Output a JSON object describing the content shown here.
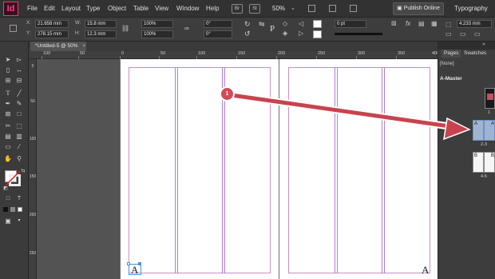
{
  "app": {
    "logo": "Id",
    "menu": [
      "File",
      "Edit",
      "Layout",
      "Type",
      "Object",
      "Table",
      "View",
      "Window",
      "Help"
    ],
    "bridge_btn": "Br",
    "stock_btn": "St",
    "zoom": "50%",
    "publish_label": "Publish Online",
    "workspace": "Typography"
  },
  "control": {
    "x_label": "X:",
    "x_value": "21.658 mm",
    "y_label": "Y:",
    "y_value": "278.15 mm",
    "w_label": "W:",
    "w_value": "15.8 mm",
    "h_label": "H:",
    "h_value": "12.3 mm",
    "scale_x": "100%",
    "scale_y": "100%",
    "rotate": "0°",
    "shear": "0°",
    "stroke_weight": "0 pt",
    "right_value": "4.233 mm"
  },
  "document": {
    "tab_title": "*Untitled-5 @ 50%",
    "page_letter_left": "A",
    "page_letter_right": "A"
  },
  "ruler": {
    "h_numbers": [
      "100",
      "50",
      "0",
      "50",
      "100",
      "150",
      "200",
      "250",
      "300",
      "350",
      "400"
    ],
    "v_numbers": [
      "0",
      "50",
      "100",
      "150",
      "200",
      "250"
    ]
  },
  "callout": {
    "number": "1"
  },
  "pages_panel": {
    "tabs": [
      "Pages",
      "Swatches"
    ],
    "none_item": "[None]",
    "master_item": "A-Master",
    "thumbs": [
      {
        "label": "1",
        "letter": ""
      },
      {
        "label": "2-3",
        "letter_left": "A",
        "letter_right": "A"
      },
      {
        "label": "4-5",
        "letter_left": "B",
        "letter_right": "B"
      }
    ]
  },
  "colors": {
    "accent": "#ff3366",
    "callout": "#d04a56",
    "margin_guide": "#c790c7",
    "column_guide": "#b47cd7"
  }
}
